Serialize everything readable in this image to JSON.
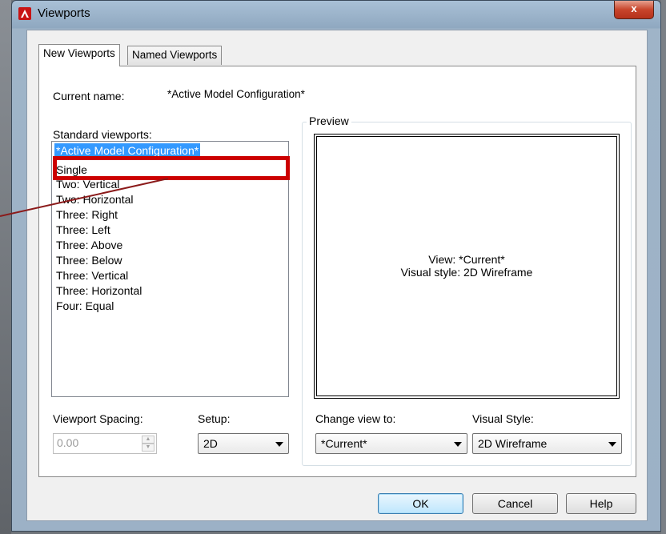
{
  "window": {
    "title": "Viewports",
    "close_label": "x"
  },
  "tabs": [
    {
      "label": "New Viewports",
      "active": true
    },
    {
      "label": "Named Viewports",
      "active": false
    }
  ],
  "current_name": {
    "label": "Current name:",
    "value": "*Active Model Configuration*"
  },
  "standard_viewports": {
    "label": "Standard viewports:",
    "items": [
      "*Active Model Configuration*",
      "Single",
      "Two:  Vertical",
      "Two:  Horizontal",
      "Three: Right",
      "Three: Left",
      "Three: Above",
      "Three: Below",
      "Three: Vertical",
      "Three: Horizontal",
      "Four:  Equal"
    ],
    "selected_index": 0
  },
  "preview": {
    "label": "Preview",
    "line1": "View: *Current*",
    "line2": "Visual style: 2D Wireframe"
  },
  "viewport_spacing": {
    "label": "Viewport Spacing:",
    "value": "0.00"
  },
  "setup": {
    "label": "Setup:",
    "value": "2D"
  },
  "change_view": {
    "label": "Change view to:",
    "value": "*Current*"
  },
  "visual_style": {
    "label": "Visual Style:",
    "value": "2D Wireframe"
  },
  "buttons": {
    "ok": "OK",
    "cancel": "Cancel",
    "help": "Help"
  },
  "colors": {
    "highlight": "#cc0000",
    "selection": "#3399ff",
    "close_button": "#c8452c"
  }
}
